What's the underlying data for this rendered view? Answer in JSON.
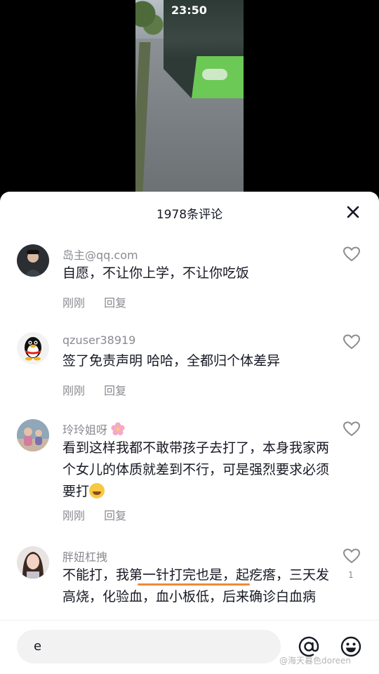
{
  "status_bar": {
    "time": "23:50"
  },
  "sheet": {
    "title": "1978条评论",
    "comments": [
      {
        "user": "岛主@qq.com",
        "text": "自愿，不让你上学，不让你吃饭",
        "time": "刚刚",
        "reply": "回复"
      },
      {
        "user": "qzuser38919",
        "text": "签了免责声明 哈哈，全都归个体差异",
        "time": "刚刚",
        "reply": "回复"
      },
      {
        "user": "玲玲姐呀",
        "text": "看到这样我都不敢带孩子去打了，本身我家两个女儿的体质就差到不行，可是强烈要求必须要打",
        "time": "刚刚",
        "reply": "回复"
      },
      {
        "user": "胖妞杠拽",
        "text": "不能打，我第一针打完也是，起疙瘩，三天发高烧，化验血，血小板低，后来确诊白血病",
        "likes": "1"
      }
    ]
  },
  "input": {
    "value": "e"
  },
  "watermark": "@海天暮色doreen",
  "icons": {
    "close": "close-icon",
    "like": "heart-outline-icon",
    "at": "at-icon",
    "emoji": "smiley-icon"
  },
  "colors": {
    "underline": "#f08a3a",
    "text": "#161823",
    "meta": "#8a8b91"
  }
}
